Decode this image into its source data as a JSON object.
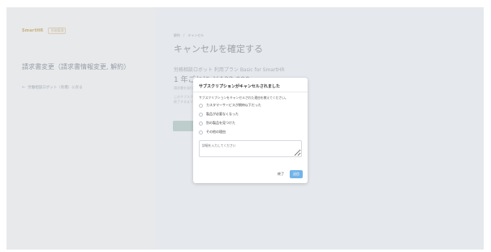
{
  "left": {
    "logo_text": "SmartHR",
    "logo_badge": "労務管理",
    "title": "請求書変更（請求書情報変更, 解約）",
    "back_link": "労働相談ロボット（有償）に戻る",
    "back_arrow": "←"
  },
  "main": {
    "breadcrumb": [
      "解約",
      "キャンセル"
    ],
    "breadcrumb_sep": "/",
    "title": "キャンセルを確定する",
    "plan": "労務相談ロボット 利用プラン Basic for SmartHR",
    "price": "1 年ごとに ￥132,000",
    "note1": "請求書を発行いたします",
    "note2": "このサブスクリプションをキャンセルすると",
    "note3": "終了するまでご利用いただけます"
  },
  "modal": {
    "title": "サブスクリプションがキャンセルされました",
    "description": "サブスクリプションをキャンセルされた理由を教えてください。",
    "options": [
      "カスタマーサービスが期待以下だった",
      "製品が必要なくなった",
      "別の製品を見つけた",
      "その他の理由"
    ],
    "textarea_placeholder": "詳細を入力してください",
    "close_label": "終了",
    "send_label": "送信"
  }
}
